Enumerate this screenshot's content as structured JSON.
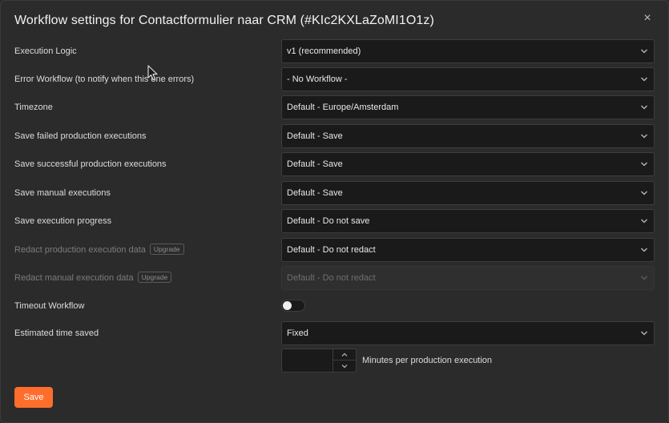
{
  "dialog": {
    "title": "Workflow settings for Contactformulier naar CRM (#KIc2KXLaZoMI1O1z)",
    "close_glyph": "×"
  },
  "settings": [
    {
      "label": "Execution Logic",
      "value": "v1 (recommended)"
    },
    {
      "label": "Error Workflow (to notify when this one errors)",
      "value": "- No Workflow -"
    },
    {
      "label": "Timezone",
      "value": "Default - Europe/Amsterdam"
    },
    {
      "label": "Save failed production executions",
      "value": "Default - Save"
    },
    {
      "label": "Save successful production executions",
      "value": "Default - Save"
    },
    {
      "label": "Save manual executions",
      "value": "Default - Save"
    },
    {
      "label": "Save execution progress",
      "value": "Default - Do not save"
    },
    {
      "label": "Redact production execution data",
      "badge": "Upgrade",
      "value": "Default - Do not redact"
    },
    {
      "label": "Redact manual execution data",
      "badge": "Upgrade",
      "value": "Default - Do not redact",
      "disabled": true
    }
  ],
  "timeout": {
    "label": "Timeout Workflow",
    "enabled": false
  },
  "time_saved": {
    "label": "Estimated time saved",
    "value": "Fixed",
    "minutes_value": "",
    "minutes_suffix": "Minutes per production execution"
  },
  "actions": {
    "save_label": "Save"
  },
  "colors": {
    "accent": "#ff6d2d",
    "background": "#2b2b2b",
    "input": "#1a1a1a"
  }
}
